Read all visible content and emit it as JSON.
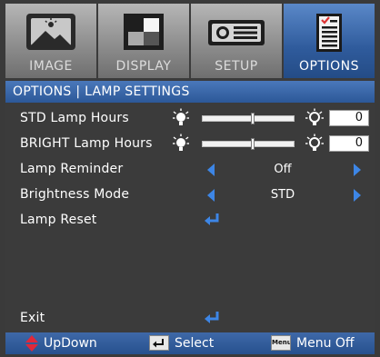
{
  "tabs": [
    {
      "label": "IMAGE",
      "icon": "image-icon",
      "active": false
    },
    {
      "label": "DISPLAY",
      "icon": "display-icon",
      "active": false
    },
    {
      "label": "SETUP",
      "icon": "projector-icon",
      "active": false
    },
    {
      "label": "OPTIONS",
      "icon": "options-checklist-icon",
      "active": true
    }
  ],
  "header": {
    "title": "OPTIONS | LAMP SETTINGS"
  },
  "rows": {
    "std_lamp_hours": {
      "label": "STD Lamp Hours",
      "value": "0",
      "level": 0.55
    },
    "bright_lamp_hours": {
      "label": "BRIGHT Lamp Hours",
      "value": "0",
      "level": 0.55
    },
    "lamp_reminder": {
      "label": "Lamp Reminder",
      "value": "Off"
    },
    "brightness_mode": {
      "label": "Brightness Mode",
      "value": "STD"
    },
    "lamp_reset": {
      "label": "Lamp Reset"
    },
    "exit": {
      "label": "Exit"
    }
  },
  "footer": {
    "updown_label": "UpDown",
    "select_label": "Select",
    "menu_key_label": "Menu",
    "menu_off_label": "Menu Off"
  },
  "colors": {
    "active_tab": "#2f5b9c",
    "arrow": "#3d86e6",
    "updown_icon": "#e0283a"
  }
}
